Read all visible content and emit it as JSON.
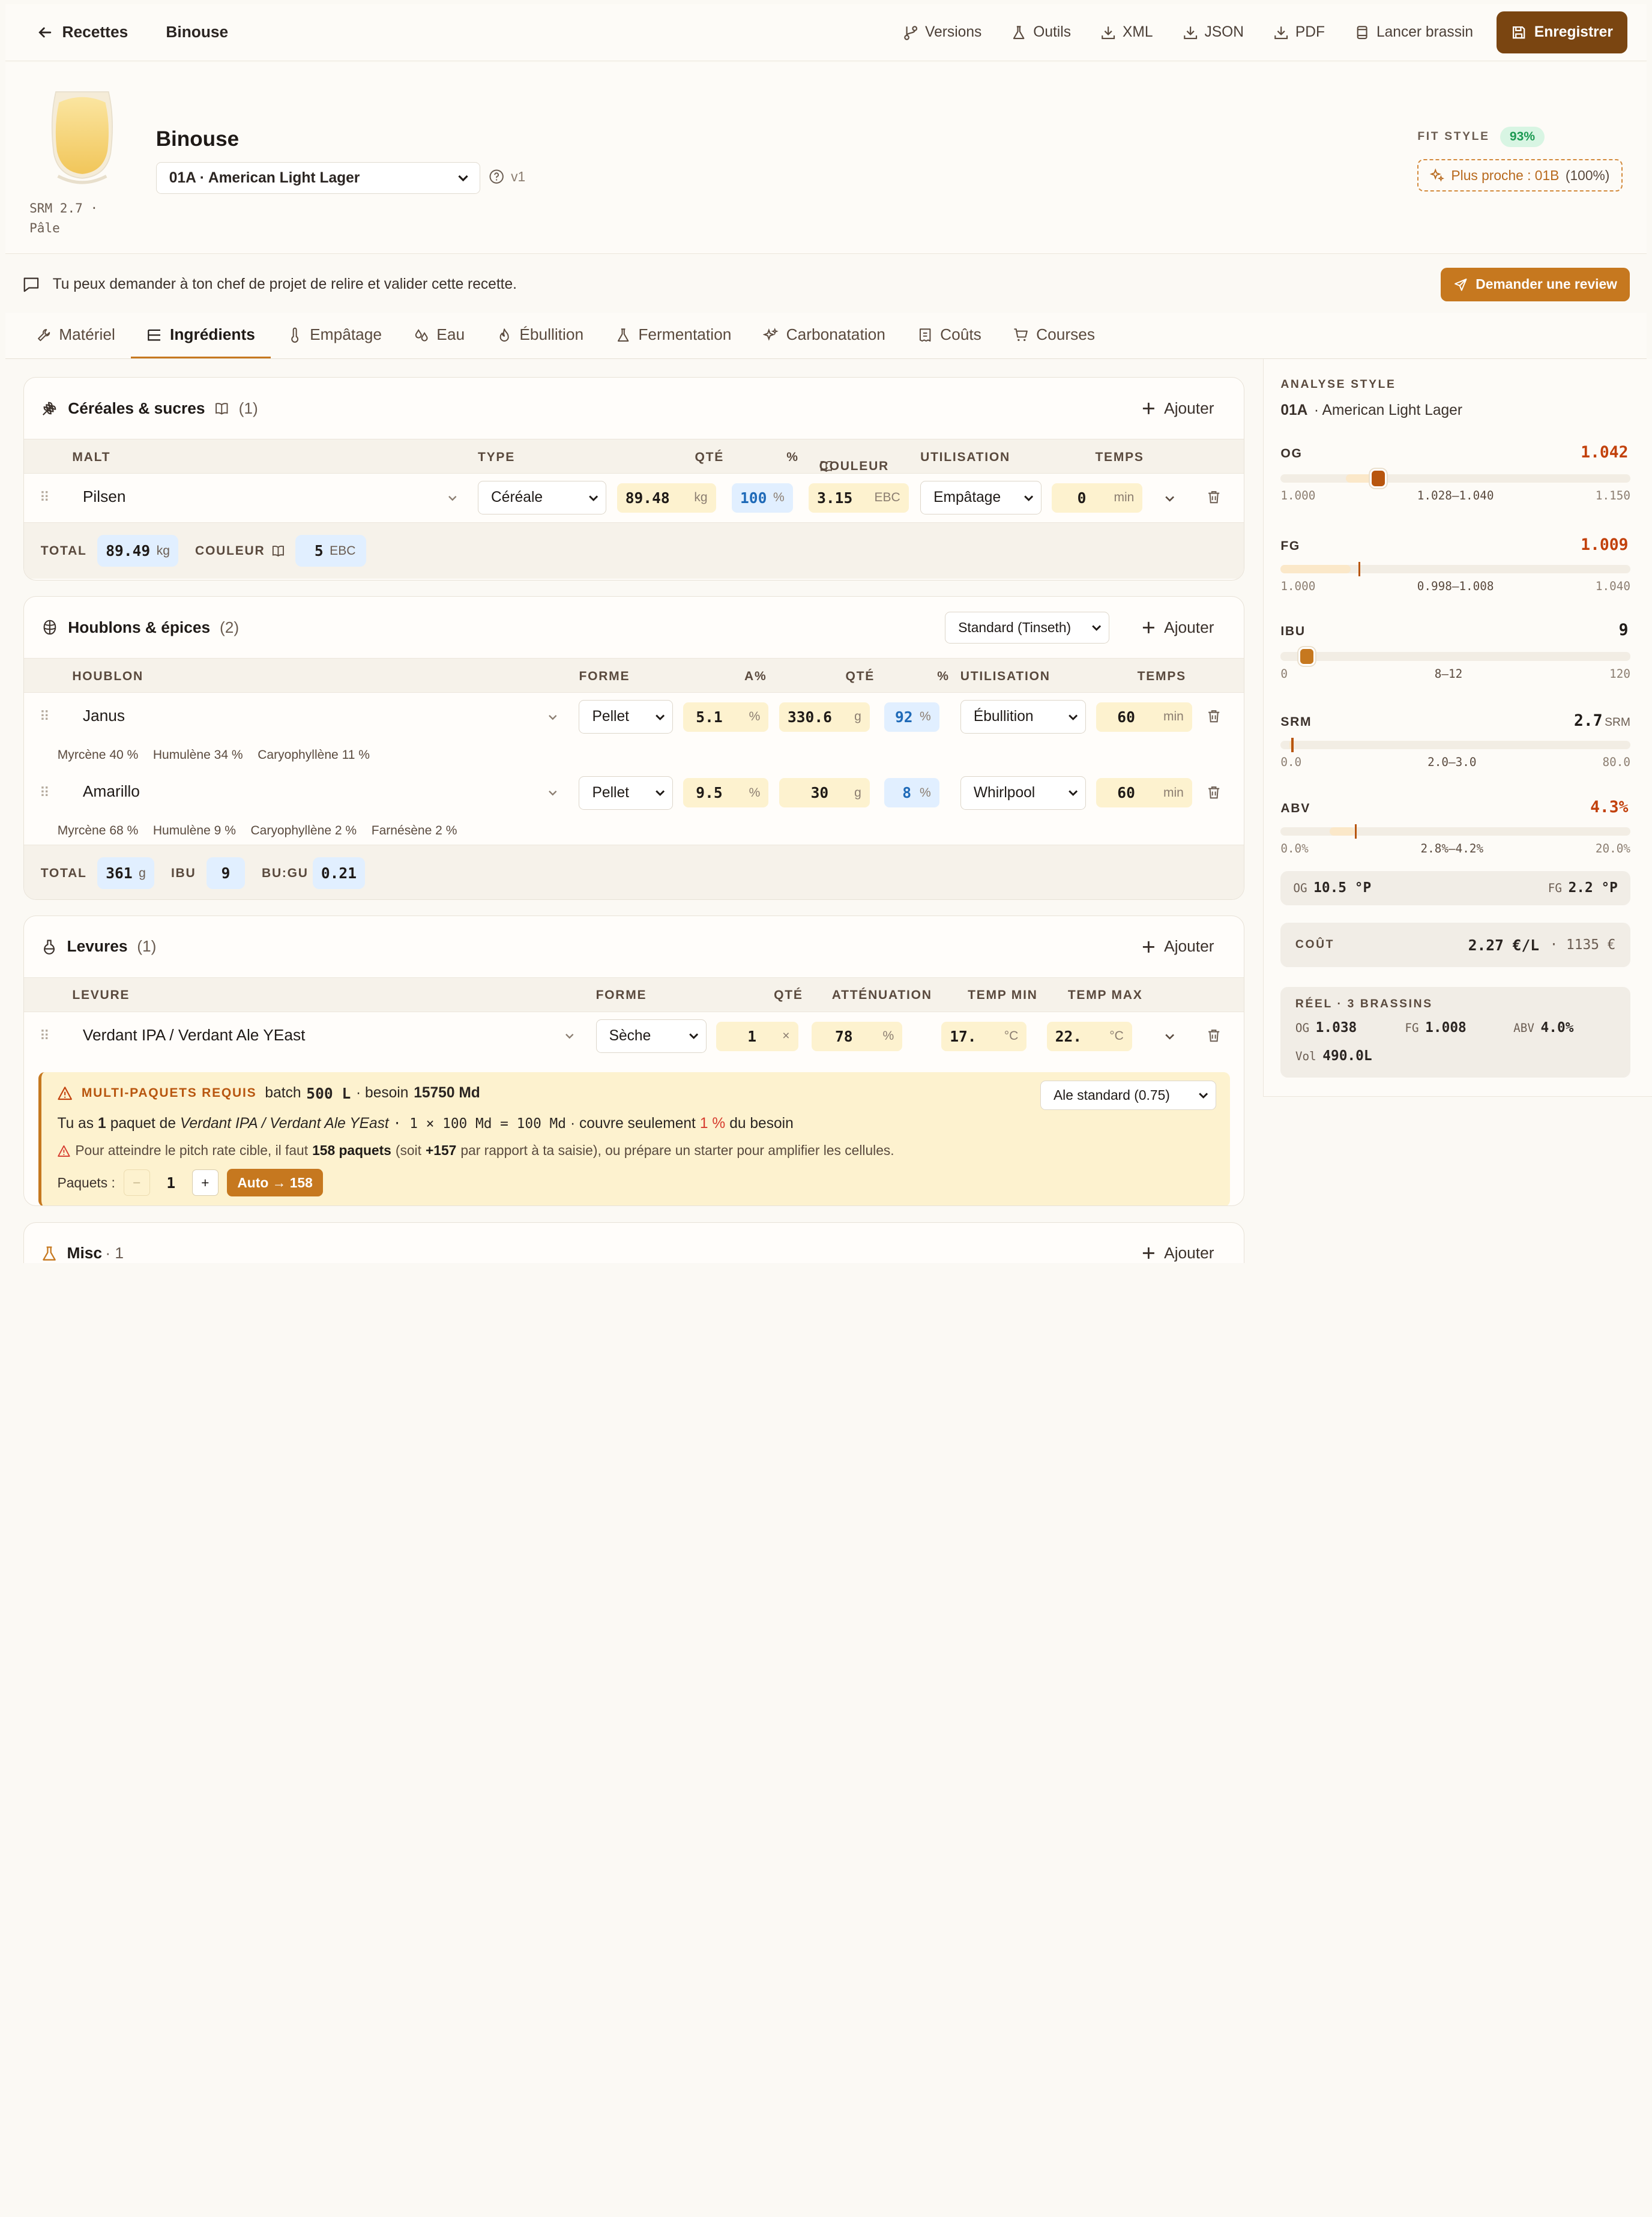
{
  "topbar": {
    "back_label": "Recettes",
    "crumb": "Binouse",
    "actions": [
      "Versions",
      "Outils",
      "XML",
      "JSON",
      "PDF",
      "Lancer brassin"
    ],
    "save_label": "Enregistrer"
  },
  "header": {
    "srm_line1": "SRM 2.7 ·",
    "srm_line2": "Pâle",
    "recipe_name": "Binouse",
    "style_selected": "01A · American Light Lager",
    "version": "v1",
    "fit_label": "FIT STYLE",
    "fit_value": "93%",
    "closest_label": "Plus proche : 01B",
    "closest_pct": "(100%)",
    "glass_color": "#f6d27a"
  },
  "review": {
    "message": "Tu peux demander à ton chef de projet de relire et valider cette recette.",
    "button": "Demander une review"
  },
  "tabs": [
    "Matériel",
    "Ingrédients",
    "Empâtage",
    "Eau",
    "Ébullition",
    "Fermentation",
    "Carbonatation",
    "Coûts",
    "Courses"
  ],
  "active_tab": "Ingrédients",
  "grains": {
    "title": "Céréales & sucres",
    "count": "(1)",
    "add_label": "Ajouter",
    "columns": [
      "MALT",
      "TYPE",
      "QTÉ",
      "%",
      "COULEUR",
      "UTILISATION",
      "TEMPS"
    ],
    "rows": [
      {
        "name": "Pilsen",
        "type": "Céréale",
        "qty": "89.48",
        "qty_unit": "kg",
        "pct": "100",
        "pct_unit": "%",
        "color": "3.15",
        "color_unit": "EBC",
        "use": "Empâtage",
        "time": "0",
        "time_unit": "min"
      }
    ],
    "footer": {
      "total_label": "TOTAL",
      "total_value": "89.49",
      "total_unit": "kg",
      "color_label": "COULEUR",
      "color_value": "5",
      "color_unit": "EBC"
    }
  },
  "hops": {
    "title": "Houblons & épices",
    "count": "(2)",
    "method": "Standard (Tinseth)",
    "add_label": "Ajouter",
    "columns": [
      "HOUBLON",
      "FORME",
      "A%",
      "QTÉ",
      "%",
      "UTILISATION",
      "TEMPS"
    ],
    "rows": [
      {
        "name": "Janus",
        "form": "Pellet",
        "alpha": "5.1",
        "qty": "330.6",
        "qty_unit": "g",
        "pct": "92",
        "use": "Ébullition",
        "time": "60",
        "time_unit": "min",
        "aromas": [
          "Myrcène 40 %",
          "Humulène 34 %",
          "Caryophyllène 11 %"
        ]
      },
      {
        "name": "Amarillo",
        "form": "Pellet",
        "alpha": "9.5",
        "qty": "30",
        "qty_unit": "g",
        "pct": "8",
        "use": "Whirlpool",
        "time": "60",
        "time_unit": "min",
        "aromas": [
          "Myrcène 68 %",
          "Humulène 9 %",
          "Caryophyllène 2 %",
          "Farnésène 2 %"
        ]
      }
    ],
    "footer": {
      "total_label": "TOTAL",
      "total_value": "361",
      "total_unit": "g",
      "ibu_label": "IBU",
      "ibu_value": "9",
      "bugu_label": "BU:GU",
      "bugu_value": "0.21"
    }
  },
  "yeast": {
    "title": "Levures",
    "count": "(1)",
    "add_label": "Ajouter",
    "columns": [
      "LEVURE",
      "FORME",
      "QTÉ",
      "ATTÉNUATION",
      "TEMP MIN",
      "TEMP MAX"
    ],
    "rows": [
      {
        "name": "Verdant IPA / Verdant Ale YEast",
        "form": "Sèche",
        "qty": "1",
        "qty_unit": "×",
        "atten": "78",
        "atten_unit": "%",
        "tmin": "17.",
        "tmin_unit": "°C",
        "tmax": "22.",
        "tmax_unit": "°C"
      }
    ],
    "multi": {
      "label": "MULTI-PAQUETS REQUIS",
      "batch_pre": "batch",
      "batch_value": "500 L",
      "need_pre": "· besoin",
      "need_value": "15750 Md",
      "rate_select": "Ale standard (0.75)",
      "line2_a": "Tu as",
      "line2_b": "1",
      "line2_c": "paquet de",
      "line2_d": "Verdant IPA / Verdant Ale YEast",
      "line2_e": "· 1 × 100 Md = 100 Md",
      "line2_f": "· couvre seulement",
      "line2_g": "1 %",
      "line2_h": "du besoin",
      "line3_a": "Pour atteindre le pitch rate cible, il faut",
      "line3_b": "158 paquets",
      "line3_c": "(soit",
      "line3_d": "+157",
      "line3_e": "par rapport à ta saisie), ou prépare un starter pour amplifier les cellules.",
      "packs_label": "Paquets :",
      "minus": "−",
      "packs_value": "1",
      "plus": "+",
      "auto_label": "Auto → 158"
    }
  },
  "misc": {
    "title": "Misc",
    "count": "· 1",
    "add_label": "Ajouter"
  },
  "analysis": {
    "title": "ANALYSE STYLE",
    "style_code": "01A",
    "style_name": "· American Light Lager",
    "metrics": [
      {
        "name": "OG",
        "value": "1.042",
        "unit": "",
        "min": "1.000",
        "range": "1.028–1.040",
        "max": "1.150",
        "frac": 0.28,
        "range_lo": 0.187,
        "range_hi": 0.267,
        "kind": "knob",
        "status_color": "#c2410c"
      },
      {
        "name": "FG",
        "value": "1.009",
        "unit": "",
        "min": "1.000",
        "range": "0.998–1.008",
        "max": "1.040",
        "frac": 0.225,
        "range_lo": 0.0,
        "range_hi": 0.2,
        "kind": "line",
        "status_color": "#c2410c"
      },
      {
        "name": "IBU",
        "value": "9",
        "unit": "",
        "min": "0",
        "range": "8–12",
        "max": "120",
        "frac": 0.075,
        "range_lo": 0.067,
        "range_hi": 0.1,
        "kind": "knob",
        "status_color": "#1f1a17"
      },
      {
        "name": "SRM",
        "value": "2.7",
        "unit": "SRM",
        "min": "0.0",
        "range": "2.0–3.0",
        "max": "80.0",
        "frac": 0.034,
        "range_lo": 0.025,
        "range_hi": 0.0375,
        "kind": "line",
        "status_color": "#1f1a17"
      },
      {
        "name": "ABV",
        "value": "4.3%",
        "unit": "",
        "min": "0.0%",
        "range": "2.8%–4.2%",
        "max": "20.0%",
        "frac": 0.215,
        "range_lo": 0.14,
        "range_hi": 0.21,
        "kind": "line",
        "status_color": "#c2410c"
      }
    ],
    "plato": {
      "og_label": "OG",
      "og_value": "10.5 °P",
      "fg_label": "FG",
      "fg_value": "2.2 °P"
    },
    "cost": {
      "label": "COÛT",
      "value": "2.27 €/L",
      "total": "· 1135 €"
    },
    "real": {
      "label": "RÉEL · 3 BRASSINS",
      "og_label": "OG",
      "og_value": "1.038",
      "fg_label": "FG",
      "fg_value": "1.008",
      "abv_label": "ABV",
      "abv_value": "4.0%",
      "vol_label": "Vol",
      "vol_value": "490.0L"
    }
  }
}
